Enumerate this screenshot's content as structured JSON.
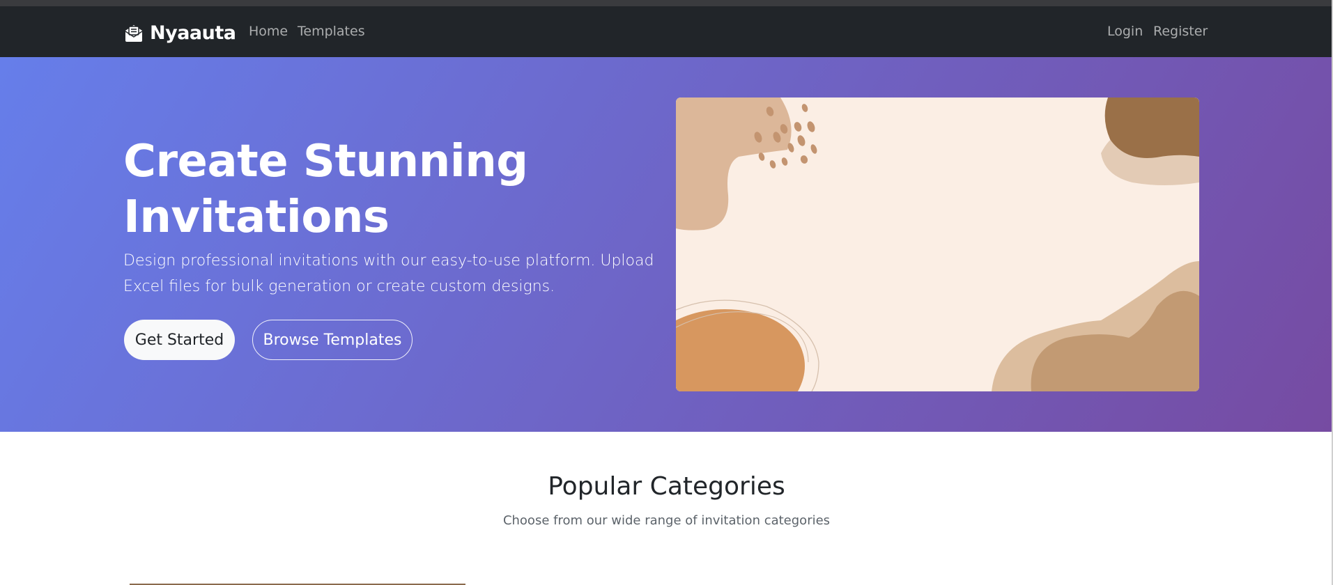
{
  "navbar": {
    "brand": "Nyaauta",
    "brand_icon": "envelope-open-icon",
    "links": [
      "Home",
      "Templates"
    ],
    "auth_links": [
      "Login",
      "Register"
    ]
  },
  "hero": {
    "title": "Create Stunning Invitations",
    "subtitle": "Design professional invitations with our easy-to-use platform. Upload Excel files for bulk generation or create custom designs.",
    "primary_button": "Get Started",
    "secondary_button": "Browse Templates",
    "gradient_start": "#667eea",
    "gradient_end": "#764ba2"
  },
  "categories": {
    "title": "Popular Categories",
    "subtitle": "Choose from our wide range of invitation categories"
  }
}
